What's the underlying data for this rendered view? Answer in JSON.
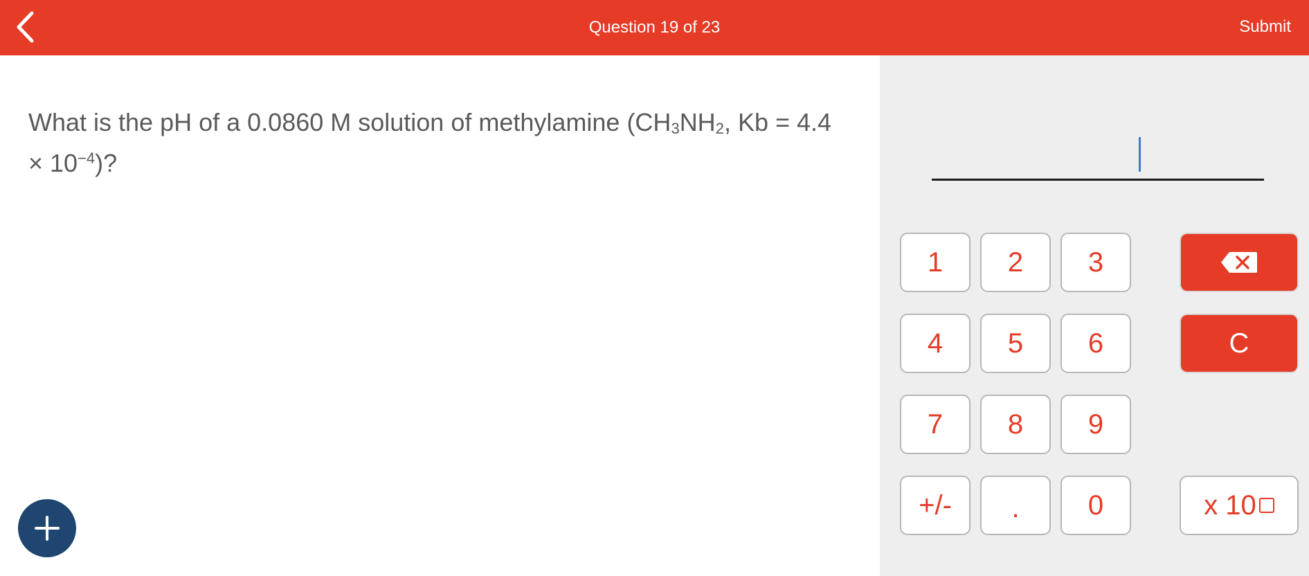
{
  "header": {
    "question_counter": "Question 19 of 23",
    "submit_label": "Submit",
    "background_color": "#e53b27"
  },
  "question": {
    "text_part1": "What is the pH of a 0.0860 M solution of methylamine (CH",
    "sub1": "3",
    "text_part2": "NH",
    "sub2": "2",
    "text_part3": ", Kb = 4.4 × 10",
    "sup1": "−4",
    "text_part4": ")?"
  },
  "answer": {
    "value": ""
  },
  "keypad": {
    "keys": [
      "1",
      "2",
      "3",
      "4",
      "5",
      "6",
      "7",
      "8",
      "9",
      "+/-",
      ".",
      "0"
    ],
    "clear_label": "C",
    "sci_label": "x 10",
    "backspace_icon": "backspace-icon",
    "accent_color": "#e53b27"
  },
  "add_button": {
    "icon": "plus-icon",
    "color": "#1f4670"
  }
}
